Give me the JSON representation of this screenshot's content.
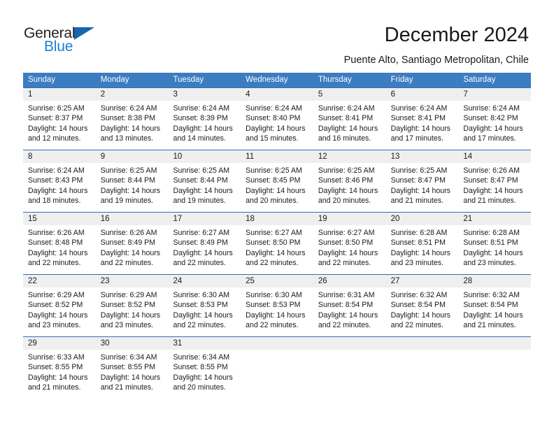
{
  "logo": {
    "word_dark": "General",
    "word_blue": "Blue",
    "triangle_color": "#1565b0",
    "blue_color": "#1a7fd4"
  },
  "header": {
    "title": "December 2024",
    "subtitle": "Puente Alto, Santiago Metropolitan, Chile",
    "header_bg": "#3c7cc0",
    "daynum_bg": "#efefef",
    "separator_color": "#2f6fb5"
  },
  "weekdays": [
    "Sunday",
    "Monday",
    "Tuesday",
    "Wednesday",
    "Thursday",
    "Friday",
    "Saturday"
  ],
  "weeks": [
    {
      "numbers": [
        "1",
        "2",
        "3",
        "4",
        "5",
        "6",
        "7"
      ],
      "cells": [
        {
          "l1": "Sunrise: 6:25 AM",
          "l2": "Sunset: 8:37 PM",
          "l3": "Daylight: 14 hours",
          "l4": "and 12 minutes."
        },
        {
          "l1": "Sunrise: 6:24 AM",
          "l2": "Sunset: 8:38 PM",
          "l3": "Daylight: 14 hours",
          "l4": "and 13 minutes."
        },
        {
          "l1": "Sunrise: 6:24 AM",
          "l2": "Sunset: 8:39 PM",
          "l3": "Daylight: 14 hours",
          "l4": "and 14 minutes."
        },
        {
          "l1": "Sunrise: 6:24 AM",
          "l2": "Sunset: 8:40 PM",
          "l3": "Daylight: 14 hours",
          "l4": "and 15 minutes."
        },
        {
          "l1": "Sunrise: 6:24 AM",
          "l2": "Sunset: 8:41 PM",
          "l3": "Daylight: 14 hours",
          "l4": "and 16 minutes."
        },
        {
          "l1": "Sunrise: 6:24 AM",
          "l2": "Sunset: 8:41 PM",
          "l3": "Daylight: 14 hours",
          "l4": "and 17 minutes."
        },
        {
          "l1": "Sunrise: 6:24 AM",
          "l2": "Sunset: 8:42 PM",
          "l3": "Daylight: 14 hours",
          "l4": "and 17 minutes."
        }
      ]
    },
    {
      "numbers": [
        "8",
        "9",
        "10",
        "11",
        "12",
        "13",
        "14"
      ],
      "cells": [
        {
          "l1": "Sunrise: 6:24 AM",
          "l2": "Sunset: 8:43 PM",
          "l3": "Daylight: 14 hours",
          "l4": "and 18 minutes."
        },
        {
          "l1": "Sunrise: 6:25 AM",
          "l2": "Sunset: 8:44 PM",
          "l3": "Daylight: 14 hours",
          "l4": "and 19 minutes."
        },
        {
          "l1": "Sunrise: 6:25 AM",
          "l2": "Sunset: 8:44 PM",
          "l3": "Daylight: 14 hours",
          "l4": "and 19 minutes."
        },
        {
          "l1": "Sunrise: 6:25 AM",
          "l2": "Sunset: 8:45 PM",
          "l3": "Daylight: 14 hours",
          "l4": "and 20 minutes."
        },
        {
          "l1": "Sunrise: 6:25 AM",
          "l2": "Sunset: 8:46 PM",
          "l3": "Daylight: 14 hours",
          "l4": "and 20 minutes."
        },
        {
          "l1": "Sunrise: 6:25 AM",
          "l2": "Sunset: 8:47 PM",
          "l3": "Daylight: 14 hours",
          "l4": "and 21 minutes."
        },
        {
          "l1": "Sunrise: 6:26 AM",
          "l2": "Sunset: 8:47 PM",
          "l3": "Daylight: 14 hours",
          "l4": "and 21 minutes."
        }
      ]
    },
    {
      "numbers": [
        "15",
        "16",
        "17",
        "18",
        "19",
        "20",
        "21"
      ],
      "cells": [
        {
          "l1": "Sunrise: 6:26 AM",
          "l2": "Sunset: 8:48 PM",
          "l3": "Daylight: 14 hours",
          "l4": "and 22 minutes."
        },
        {
          "l1": "Sunrise: 6:26 AM",
          "l2": "Sunset: 8:49 PM",
          "l3": "Daylight: 14 hours",
          "l4": "and 22 minutes."
        },
        {
          "l1": "Sunrise: 6:27 AM",
          "l2": "Sunset: 8:49 PM",
          "l3": "Daylight: 14 hours",
          "l4": "and 22 minutes."
        },
        {
          "l1": "Sunrise: 6:27 AM",
          "l2": "Sunset: 8:50 PM",
          "l3": "Daylight: 14 hours",
          "l4": "and 22 minutes."
        },
        {
          "l1": "Sunrise: 6:27 AM",
          "l2": "Sunset: 8:50 PM",
          "l3": "Daylight: 14 hours",
          "l4": "and 22 minutes."
        },
        {
          "l1": "Sunrise: 6:28 AM",
          "l2": "Sunset: 8:51 PM",
          "l3": "Daylight: 14 hours",
          "l4": "and 23 minutes."
        },
        {
          "l1": "Sunrise: 6:28 AM",
          "l2": "Sunset: 8:51 PM",
          "l3": "Daylight: 14 hours",
          "l4": "and 23 minutes."
        }
      ]
    },
    {
      "numbers": [
        "22",
        "23",
        "24",
        "25",
        "26",
        "27",
        "28"
      ],
      "cells": [
        {
          "l1": "Sunrise: 6:29 AM",
          "l2": "Sunset: 8:52 PM",
          "l3": "Daylight: 14 hours",
          "l4": "and 23 minutes."
        },
        {
          "l1": "Sunrise: 6:29 AM",
          "l2": "Sunset: 8:52 PM",
          "l3": "Daylight: 14 hours",
          "l4": "and 23 minutes."
        },
        {
          "l1": "Sunrise: 6:30 AM",
          "l2": "Sunset: 8:53 PM",
          "l3": "Daylight: 14 hours",
          "l4": "and 22 minutes."
        },
        {
          "l1": "Sunrise: 6:30 AM",
          "l2": "Sunset: 8:53 PM",
          "l3": "Daylight: 14 hours",
          "l4": "and 22 minutes."
        },
        {
          "l1": "Sunrise: 6:31 AM",
          "l2": "Sunset: 8:54 PM",
          "l3": "Daylight: 14 hours",
          "l4": "and 22 minutes."
        },
        {
          "l1": "Sunrise: 6:32 AM",
          "l2": "Sunset: 8:54 PM",
          "l3": "Daylight: 14 hours",
          "l4": "and 22 minutes."
        },
        {
          "l1": "Sunrise: 6:32 AM",
          "l2": "Sunset: 8:54 PM",
          "l3": "Daylight: 14 hours",
          "l4": "and 21 minutes."
        }
      ]
    },
    {
      "numbers": [
        "29",
        "30",
        "31",
        "",
        "",
        "",
        ""
      ],
      "cells": [
        {
          "l1": "Sunrise: 6:33 AM",
          "l2": "Sunset: 8:55 PM",
          "l3": "Daylight: 14 hours",
          "l4": "and 21 minutes."
        },
        {
          "l1": "Sunrise: 6:34 AM",
          "l2": "Sunset: 8:55 PM",
          "l3": "Daylight: 14 hours",
          "l4": "and 21 minutes."
        },
        {
          "l1": "Sunrise: 6:34 AM",
          "l2": "Sunset: 8:55 PM",
          "l3": "Daylight: 14 hours",
          "l4": "and 20 minutes."
        },
        {
          "l1": "",
          "l2": "",
          "l3": "",
          "l4": ""
        },
        {
          "l1": "",
          "l2": "",
          "l3": "",
          "l4": ""
        },
        {
          "l1": "",
          "l2": "",
          "l3": "",
          "l4": ""
        },
        {
          "l1": "",
          "l2": "",
          "l3": "",
          "l4": ""
        }
      ]
    }
  ]
}
